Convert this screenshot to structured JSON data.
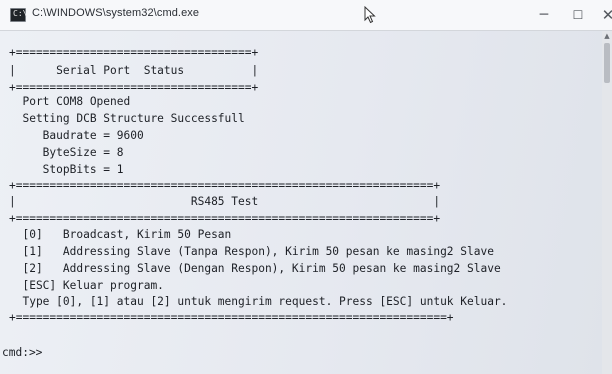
{
  "window": {
    "title": "C:\\WINDOWS\\system32\\cmd.exe",
    "icon": "cmd-icon",
    "controls": {
      "minimize": "─",
      "maximize": "☐",
      "close": "✕"
    }
  },
  "console": {
    "status_box": {
      "border_top": "+===================================+",
      "title_line": "|      Serial Port  Status          |",
      "border_bottom": "+===================================+"
    },
    "status_lines": [
      "  Port COM8 Opened",
      "  Setting DCB Structure Successfull",
      "     Baudrate = 9600",
      "     ByteSize = 8",
      "     StopBits = 1"
    ],
    "test_box": {
      "border_top": "+==============================================================+",
      "title_line": "|                          RS485 Test                          |",
      "border_bottom": "+==============================================================+"
    },
    "menu_lines": [
      "  [0]   Broadcast, Kirim 50 Pesan",
      "  [1]   Addressing Slave (Tanpa Respon), Kirim 50 pesan ke masing2 Slave",
      "  [2]   Addressing Slave (Dengan Respon), Kirim 50 pesan ke masing2 Slave",
      "  [ESC] Keluar program.",
      "  Type [0], [1] atau [2] untuk mengirim request. Press [ESC] untuk Keluar."
    ],
    "menu_border_bottom": "+================================================================+",
    "prompt": "cmd:>>"
  }
}
